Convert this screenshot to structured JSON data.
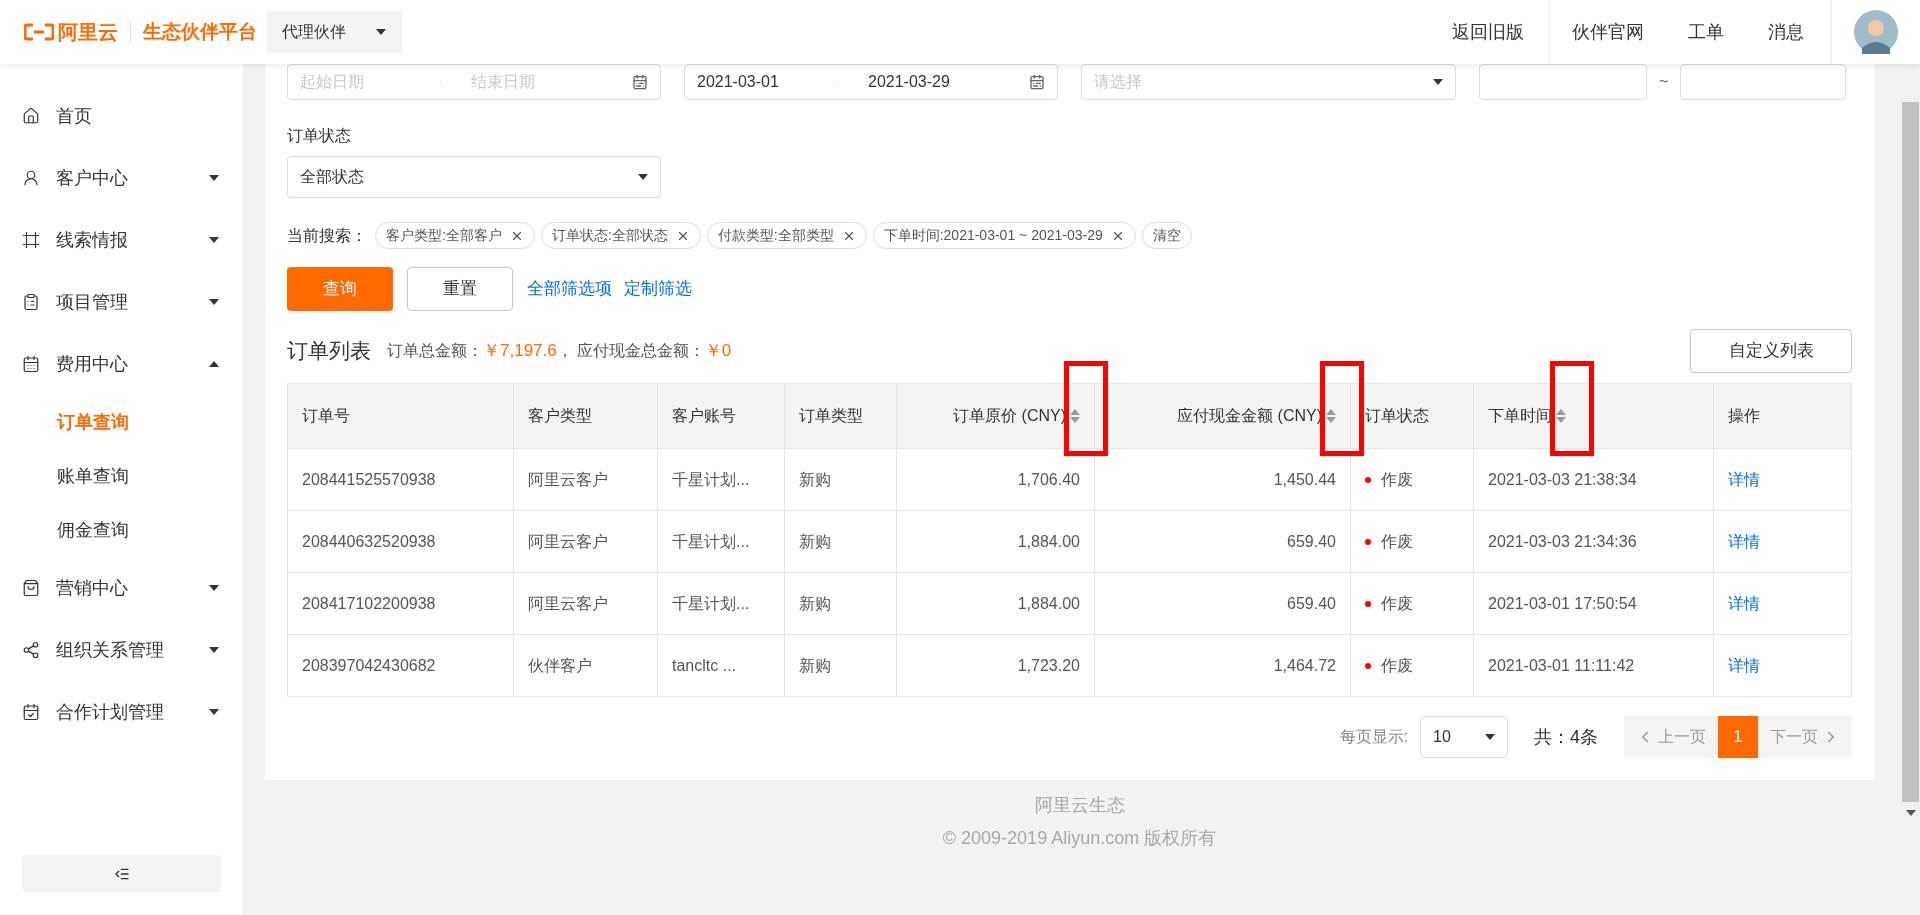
{
  "header": {
    "logo": "阿里云",
    "platform": "生态伙伴平台",
    "role_select": "代理伙伴",
    "nav": [
      "返回旧版",
      "伙伴官网",
      "工单",
      "消息"
    ]
  },
  "sidebar": {
    "items": [
      {
        "label": "首页",
        "selected": false
      },
      {
        "label": "客户中心",
        "expanded": false,
        "selected": false
      },
      {
        "label": "线索情报",
        "expanded": false,
        "selected": false
      },
      {
        "label": "项目管理",
        "expanded": false,
        "selected": false
      },
      {
        "label": "费用中心",
        "expanded": true,
        "selected": false,
        "children": [
          {
            "label": "订单查询",
            "selected": true
          },
          {
            "label": "账单查询",
            "selected": false
          },
          {
            "label": "佣金查询",
            "selected": false
          }
        ]
      },
      {
        "label": "营销中心",
        "expanded": false,
        "selected": false
      },
      {
        "label": "组织关系管理",
        "expanded": false,
        "selected": false
      },
      {
        "label": "合作计划管理",
        "expanded": false,
        "selected": false
      }
    ]
  },
  "filters": {
    "top_row": [
      {
        "kind": "date_range",
        "start": {
          "placeholder": "起始日期"
        },
        "end": {
          "placeholder": "结束日期"
        }
      },
      {
        "kind": "date_range",
        "start": {
          "value": "2021-03-01"
        },
        "end": {
          "value": "2021-03-29"
        }
      },
      {
        "kind": "select",
        "placeholder": "请选择"
      },
      {
        "kind": "range",
        "separator": "~"
      }
    ],
    "status": {
      "label": "订单状态",
      "value": "全部状态"
    },
    "current_search": {
      "label": "当前搜索：",
      "tags": [
        "客户类型:全部客户",
        "订单状态:全部状态",
        "付款类型:全部类型",
        "下单时间:2021-03-01 ~ 2021-03-29"
      ],
      "clear": "清空"
    },
    "query_button": "查询",
    "reset_button": "重置",
    "links": [
      "全部筛选项",
      "定制筛选"
    ]
  },
  "order_list": {
    "title": "订单列表",
    "totals": [
      {
        "label": "订单总金额：",
        "value": "￥7,197.6",
        "separator": "，"
      },
      {
        "label": "应付现金总金额：",
        "value": "￥0"
      }
    ],
    "customize_button": "自定义列表"
  },
  "table": {
    "columns": [
      {
        "label": "订单号",
        "sortable": false,
        "highlighted": false
      },
      {
        "label": "客户类型",
        "sortable": false,
        "highlighted": false
      },
      {
        "label": "客户账号",
        "sortable": false,
        "highlighted": false
      },
      {
        "label": "订单类型",
        "sortable": false,
        "highlighted": false
      },
      {
        "label": "订单原价 (CNY)",
        "sortable": true,
        "highlighted": true
      },
      {
        "label": "应付现金金额 (CNY)",
        "sortable": true,
        "highlighted": true
      },
      {
        "label": "订单状态",
        "sortable": false,
        "highlighted": false
      },
      {
        "label": "下单时间",
        "sortable": true,
        "highlighted": true
      },
      {
        "label": "操作",
        "sortable": false,
        "highlighted": false
      }
    ],
    "rows": [
      {
        "order_no": "208441525570938",
        "customer_type": "阿里云客户",
        "account": "千星计划...",
        "order_type": "新购",
        "original_price": "1,706.40",
        "cash_due": "1,450.44",
        "status": {
          "text": "作废",
          "color": "#ff0000"
        },
        "time": "2021-03-03 21:38:34",
        "action": "详情"
      },
      {
        "order_no": "208440632520938",
        "customer_type": "阿里云客户",
        "account": "千星计划...",
        "order_type": "新购",
        "original_price": "1,884.00",
        "cash_due": "659.40",
        "status": {
          "text": "作废",
          "color": "#ff0000"
        },
        "time": "2021-03-03 21:34:36",
        "action": "详情"
      },
      {
        "order_no": "208417102200938",
        "customer_type": "阿里云客户",
        "account": "千星计划...",
        "order_type": "新购",
        "original_price": "1,884.00",
        "cash_due": "659.40",
        "status": {
          "text": "作废",
          "color": "#ff0000"
        },
        "time": "2021-03-01 17:50:54",
        "action": "详情"
      },
      {
        "order_no": "208397042430682",
        "customer_type": "伙伴客户",
        "account": "tancltc ...",
        "order_type": "新购",
        "original_price": "1,723.20",
        "cash_due": "1,464.72",
        "status": {
          "text": "作废",
          "color": "#ff0000"
        },
        "time": "2021-03-01 11:11:42",
        "action": "详情"
      }
    ]
  },
  "pagination": {
    "page_size_label": "每页显示:",
    "page_size": "10",
    "total": "共：4条",
    "prev": {
      "label": "上一页",
      "disabled": true
    },
    "pages": [
      {
        "label": "1",
        "selected": true
      }
    ],
    "next": {
      "label": "下一页",
      "disabled": true
    }
  },
  "footer": [
    "阿里云生态",
    "© 2009-2019 Aliyun.com 版权所有"
  ]
}
